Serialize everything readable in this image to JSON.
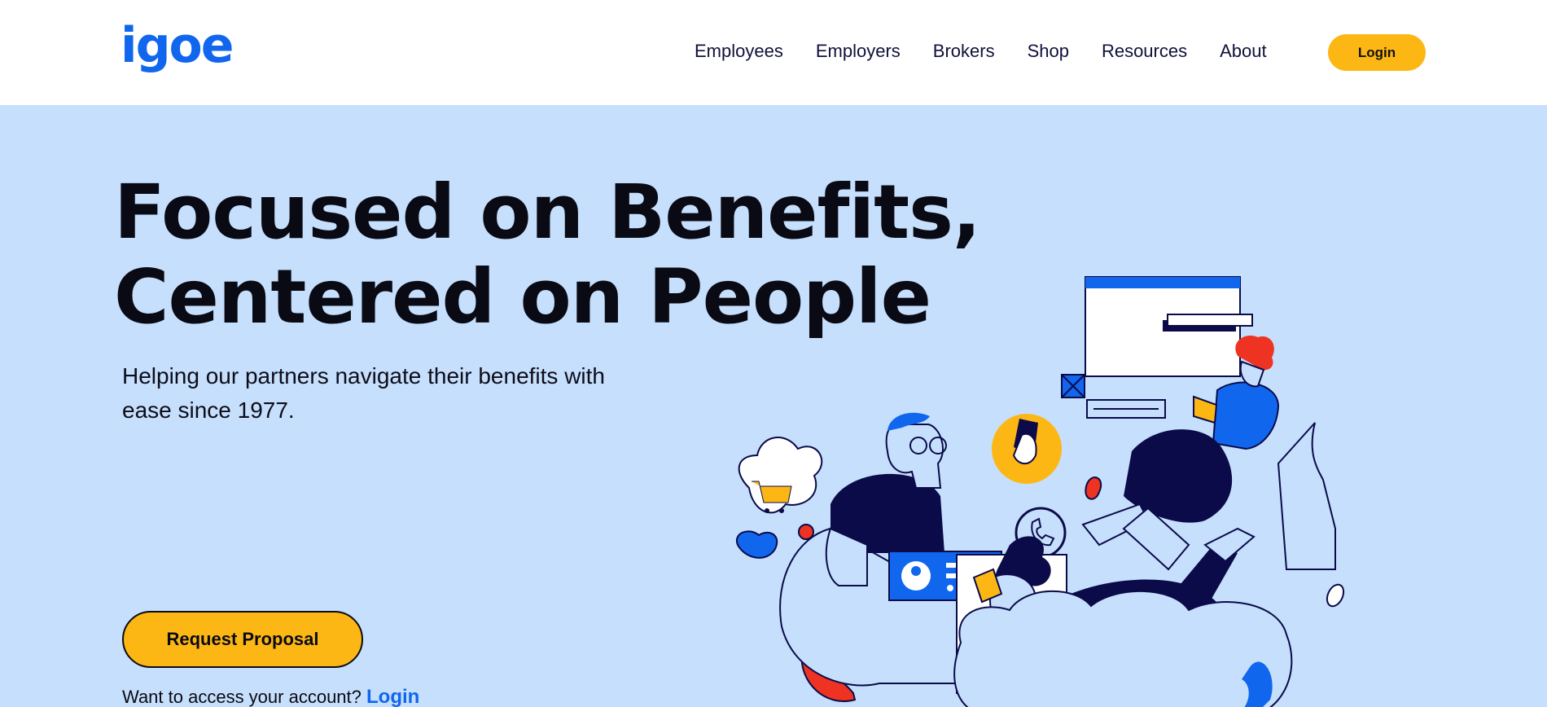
{
  "header": {
    "logo": "igoe",
    "nav": [
      "Employees",
      "Employers",
      "Brokers",
      "Shop",
      "Resources",
      "About"
    ],
    "login_label": "Login"
  },
  "hero": {
    "headline_line1": "Focused on Benefits,",
    "headline_line2": "Centered on People",
    "subtext": "Helping our partners navigate their benefits with ease since 1977.",
    "cta_label": "Request Proposal",
    "access_text": "Want to access your account?",
    "access_link": "Login"
  },
  "colors": {
    "brand_blue": "#1166ee",
    "accent_yellow": "#fdb714",
    "hero_bg": "#c6dffc",
    "navy": "#0b0b4a",
    "red": "#ee3322"
  }
}
